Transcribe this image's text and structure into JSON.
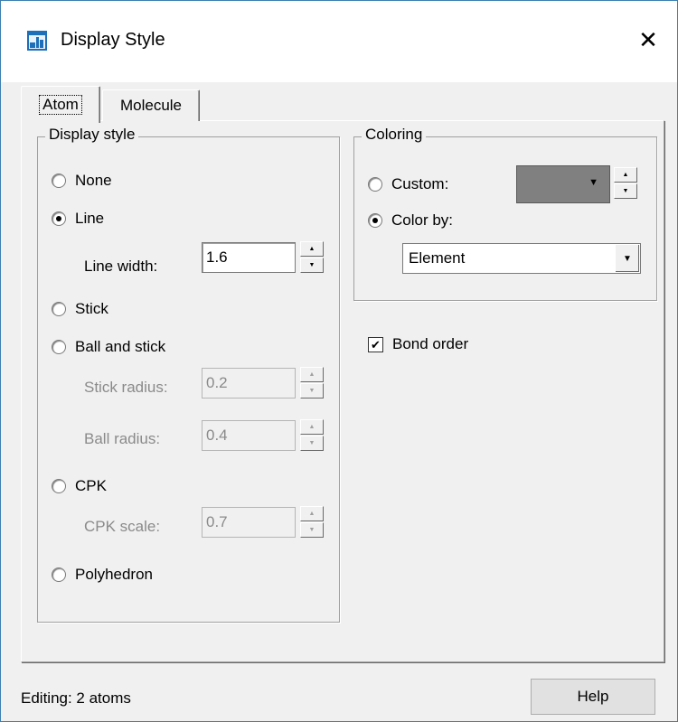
{
  "window": {
    "title": "Display Style",
    "app_icon": "window-app-icon",
    "close_glyph": "✕"
  },
  "tabs": [
    {
      "label": "Atom",
      "selected": true
    },
    {
      "label": "Molecule",
      "selected": false
    }
  ],
  "display_style": {
    "legend": "Display style",
    "options": {
      "none": {
        "label": "None",
        "checked": false
      },
      "line": {
        "label": "Line",
        "checked": true
      },
      "stick": {
        "label": "Stick",
        "checked": false
      },
      "ball_and_stick": {
        "label": "Ball and stick",
        "checked": false
      },
      "cpk": {
        "label": "CPK",
        "checked": false
      },
      "polyhedron": {
        "label": "Polyhedron",
        "checked": false
      }
    },
    "line_width": {
      "label": "Line width:",
      "value": "1.6",
      "enabled": true
    },
    "stick_radius": {
      "label": "Stick radius:",
      "value": "0.2",
      "enabled": false
    },
    "ball_radius": {
      "label": "Ball radius:",
      "value": "0.4",
      "enabled": false
    },
    "cpk_scale": {
      "label": "CPK scale:",
      "value": "0.7",
      "enabled": false
    }
  },
  "coloring": {
    "legend": "Coloring",
    "custom": {
      "label": "Custom:",
      "checked": false,
      "color": "#808080"
    },
    "color_by": {
      "label": "Color by:",
      "checked": true,
      "selected": "Element"
    }
  },
  "bond_order": {
    "label": "Bond order",
    "checked": true
  },
  "status": {
    "text": "Editing: 2 atoms"
  },
  "help_button": {
    "label": "Help"
  },
  "glyphs": {
    "spin_up": "▲",
    "spin_down": "▼",
    "dropdown": "▼",
    "check": "✔"
  }
}
